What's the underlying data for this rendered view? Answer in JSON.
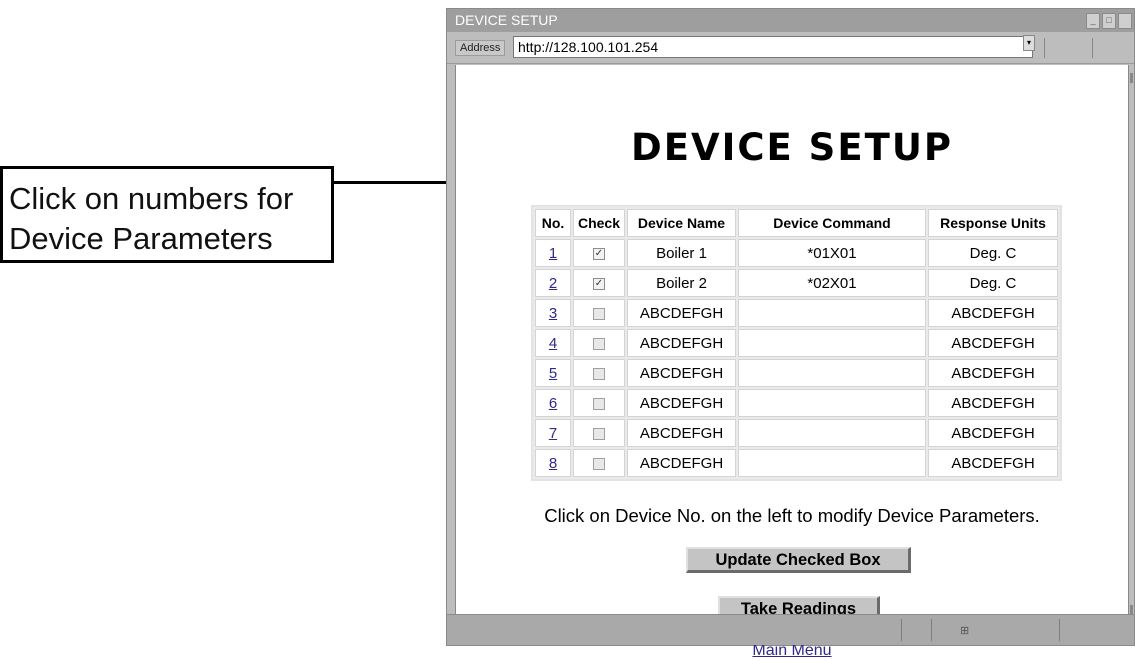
{
  "callout": {
    "line1": "Click on numbers for",
    "line2": "Device Parameters"
  },
  "window": {
    "title": "DEVICE SETUP"
  },
  "addressbar": {
    "label": "Address",
    "url": "http://128.100.101.254"
  },
  "page": {
    "title": "DEVICE SETUP",
    "instructions": "Click on Device No. on the left to modify Device Parameters.",
    "update_button": "Update Checked Box",
    "readings_button": "Take Readings",
    "main_menu_link": "Main Menu"
  },
  "table": {
    "headers": [
      "No.",
      "Check",
      "Device Name",
      "Device Command",
      "Response Units"
    ],
    "rows": [
      {
        "no": "1",
        "checked": true,
        "name": "Boiler 1",
        "command": "*01X01",
        "units": "Deg. C"
      },
      {
        "no": "2",
        "checked": true,
        "name": "Boiler 2",
        "command": "*02X01",
        "units": "Deg. C"
      },
      {
        "no": "3",
        "checked": false,
        "name": "ABCDEFGH",
        "command": "",
        "units": "ABCDEFGH"
      },
      {
        "no": "4",
        "checked": false,
        "name": "ABCDEFGH",
        "command": "",
        "units": "ABCDEFGH"
      },
      {
        "no": "5",
        "checked": false,
        "name": "ABCDEFGH",
        "command": "",
        "units": "ABCDEFGH"
      },
      {
        "no": "6",
        "checked": false,
        "name": "ABCDEFGH",
        "command": "",
        "units": "ABCDEFGH"
      },
      {
        "no": "7",
        "checked": false,
        "name": "ABCDEFGH",
        "command": "",
        "units": "ABCDEFGH"
      },
      {
        "no": "8",
        "checked": false,
        "name": "ABCDEFGH",
        "command": "",
        "units": "ABCDEFGH"
      }
    ]
  },
  "icons": {
    "check_mark": "✓",
    "dropdown": "▾",
    "status": "network-icon"
  }
}
